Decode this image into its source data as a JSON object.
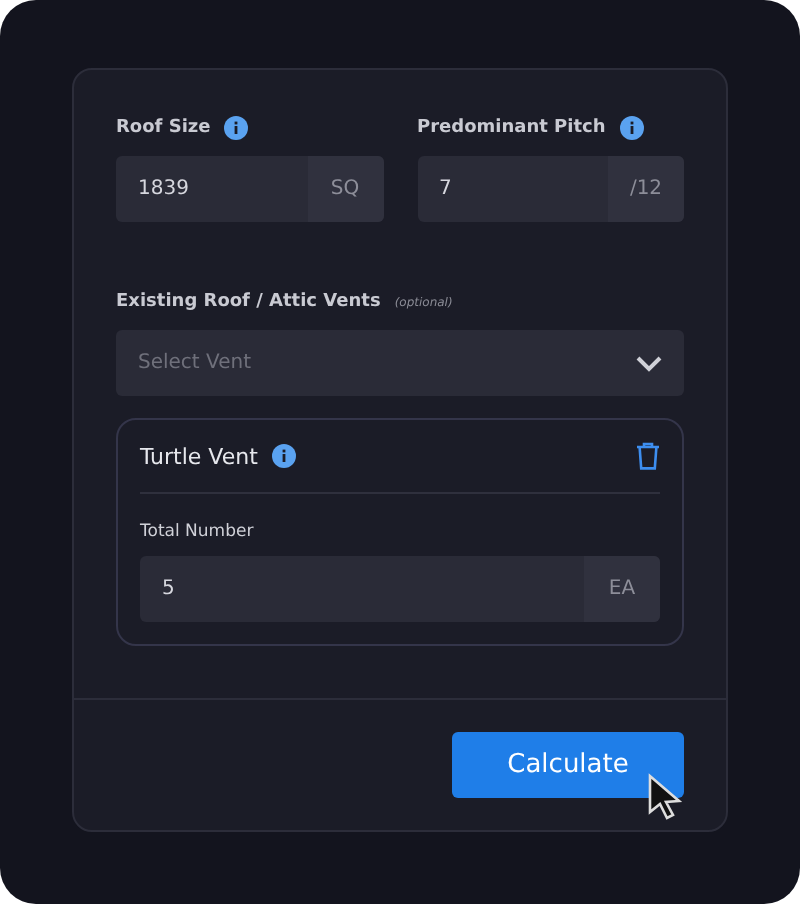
{
  "fields": [
    {
      "label": "Roof Size",
      "value": "1839",
      "unit": "SQ"
    },
    {
      "label": "Predominant Pitch",
      "value": "7",
      "unit": "/12"
    }
  ],
  "vents": {
    "label": "Existing Roof / Attic Vents",
    "note": "(optional)",
    "placeholder": "Select Vent"
  },
  "vent_card": {
    "title": "Turtle Vent",
    "field_label": "Total Number",
    "value": "5",
    "unit": "EA"
  },
  "button": "Calculate"
}
